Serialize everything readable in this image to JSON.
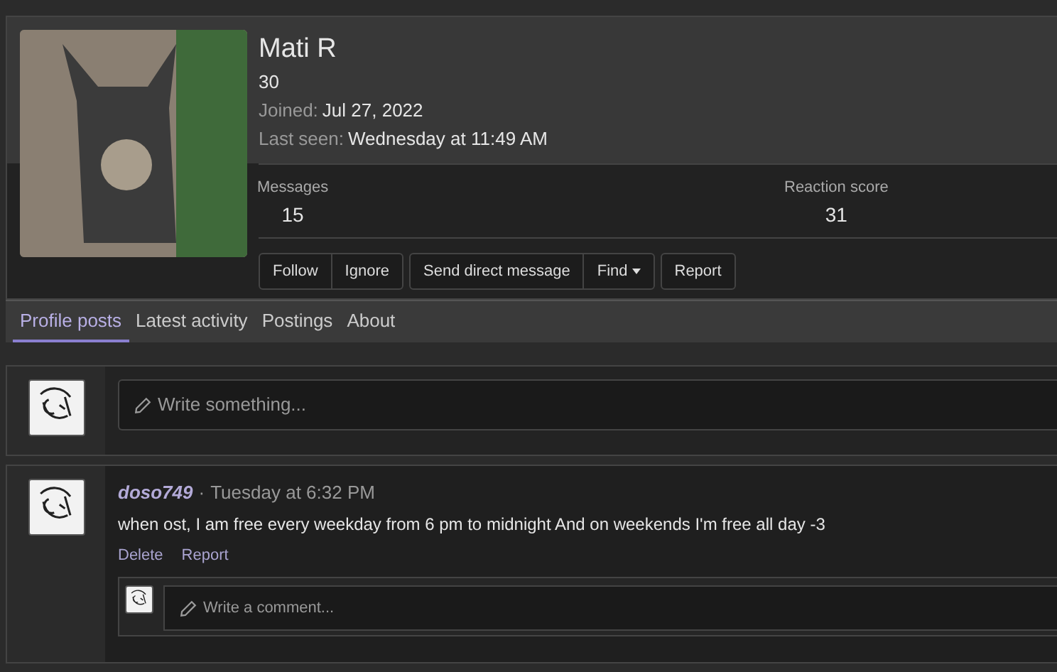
{
  "profile": {
    "name": "Mati R",
    "age": "30",
    "joined": {
      "label": "Joined:",
      "value": "Jul 27, 2022"
    },
    "last_seen": {
      "label": "Last seen:",
      "value": "Wednesday at 11:49 AM"
    },
    "stats": [
      {
        "label": "Messages",
        "value": "15"
      },
      {
        "label": "Reaction score",
        "value": "31"
      }
    ],
    "action_groups": [
      [
        {
          "label": "Follow",
          "has_menu": false
        },
        {
          "label": "Ignore",
          "has_menu": false
        }
      ],
      [
        {
          "label": "Send direct message",
          "has_menu": false
        },
        {
          "label": "Find",
          "has_menu": true
        }
      ],
      [
        {
          "label": "Report",
          "has_menu": false
        }
      ]
    ]
  },
  "tabs": [
    {
      "label": "Profile posts",
      "selected": true
    },
    {
      "label": "Latest activity",
      "selected": false
    },
    {
      "label": "Postings",
      "selected": false
    },
    {
      "label": "About",
      "selected": false
    }
  ],
  "composer": {
    "placeholder": "Write something..."
  },
  "posts": [
    {
      "author": "doso749",
      "separator": "·",
      "time": "Tuesday at 6:32 PM",
      "body": "when ost, I am free every weekday from 6 pm to midnight And on weekends I'm free all day -3",
      "actions": [
        "Delete",
        "Report"
      ],
      "comment_placeholder": "Write a comment..."
    }
  ]
}
